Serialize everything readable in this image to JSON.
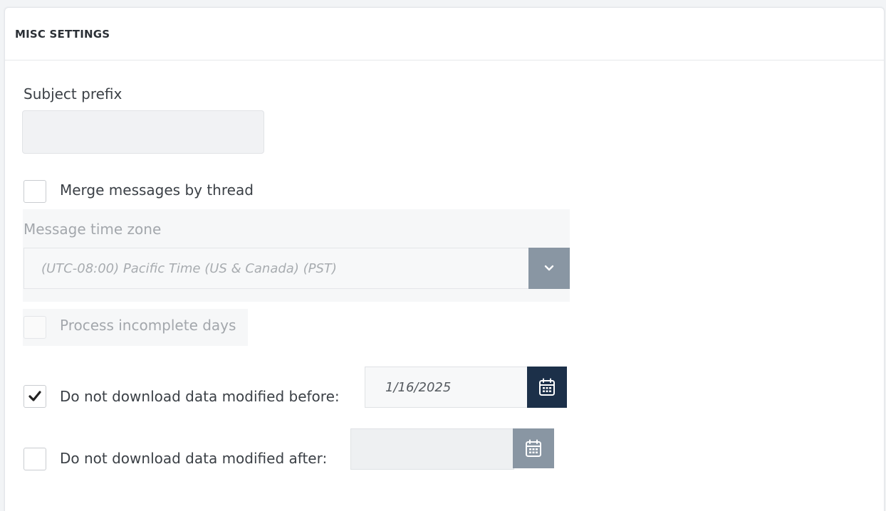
{
  "panel": {
    "title": "MISC SETTINGS"
  },
  "subject": {
    "label": "Subject prefix",
    "value": ""
  },
  "merge": {
    "label": "Merge messages by thread",
    "checked": false
  },
  "timezone": {
    "label": "Message time zone",
    "selected": "(UTC-08:00) Pacific Time (US & Canada) (PST)",
    "disabled": true
  },
  "incomplete": {
    "label": "Process incomplete days",
    "checked": false,
    "disabled": true
  },
  "before": {
    "label": "Do not download data modified before:",
    "checked": true,
    "value": "1/16/2025"
  },
  "after": {
    "label": "Do not download data modified after:",
    "checked": false,
    "value": ""
  },
  "colors": {
    "calendar_active": "#1c3049",
    "calendar_disabled": "#8996a3",
    "dropdown_button": "#8996a3"
  },
  "icons": {
    "checkmark": "check-icon",
    "dropdown": "chevron-down-icon",
    "calendar": "calendar-icon"
  }
}
